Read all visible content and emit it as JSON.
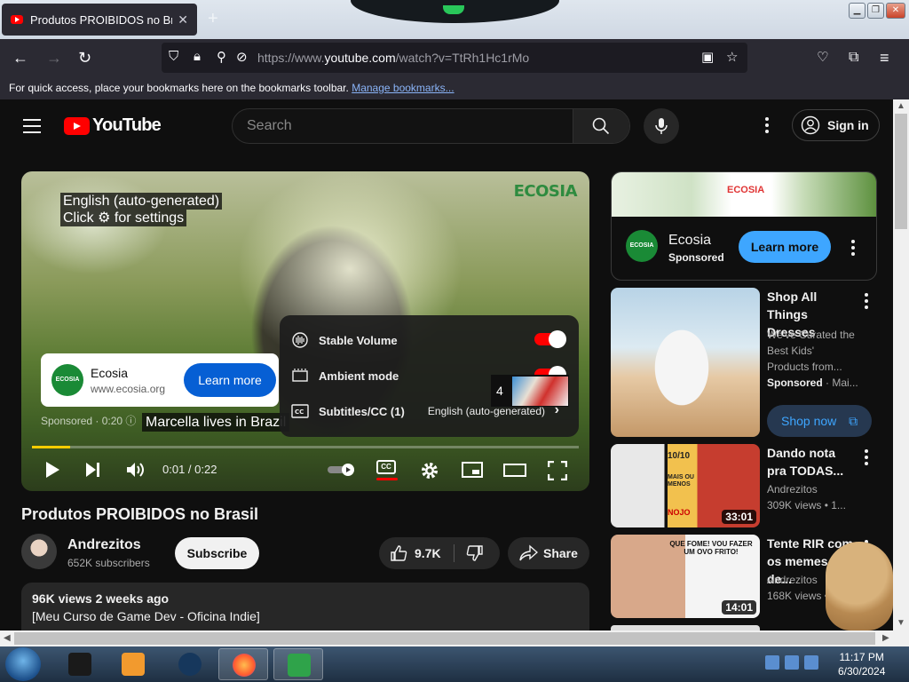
{
  "browser": {
    "tab_title": "Produtos PROIBIDOS no Brasil",
    "tab_close": "✕",
    "new_tab": "+",
    "url_prefix": "https://www.",
    "url_domain": "youtube.com",
    "url_path": "/watch?v=TtRh1Hc1rMo",
    "bookmarks_text": "For quick access, place your bookmarks here on the bookmarks toolbar.",
    "bookmarks_link": "Manage bookmarks..."
  },
  "youtube": {
    "logo_text": "YouTube",
    "search_placeholder": "Search",
    "sign_in": "Sign in"
  },
  "player": {
    "watermark": "ECOSIA",
    "caption_line1": "English (auto-generated)",
    "caption_line2": "Click ⚙ for settings",
    "subtitle_text": "Marcella lives in Brazil",
    "ad": {
      "logo": "ECOSIA",
      "name": "Ecosia",
      "url": "www.ecosia.org",
      "cta": "Learn more",
      "sponsored": "Sponsored · 0:20 ⓘ"
    },
    "progress_fraction": 0.07,
    "time": "0:01 / 0:22",
    "cc_label": "CC",
    "settings": [
      {
        "label": "Stable Volume",
        "kind": "toggle",
        "on": true
      },
      {
        "label": "Ambient mode",
        "kind": "toggle",
        "on": true
      },
      {
        "label": "Subtitles/CC (1)",
        "kind": "value",
        "value": "English (auto-generated)"
      }
    ],
    "queue_number": "4"
  },
  "video": {
    "title": "Produtos PROIBIDOS no Brasil",
    "channel": "Andrezitos",
    "subscribers": "652K subscribers",
    "subscribe": "Subscribe",
    "likes": "9.7K",
    "share": "Share",
    "views_date": "96K views  2 weeks ago",
    "description_first": "[Meu Curso de Game Dev - Oficina Indie]"
  },
  "sidebar": {
    "ad": {
      "banner_brand": "ECOSIA",
      "logo": "ECOSIA",
      "name": "Ecosia",
      "sponsored": "Sponsored",
      "cta": "Learn more"
    },
    "shop_ad": {
      "title": "Shop All Things Dresses",
      "desc": "We've Curated the Best Kids' Products from...",
      "sponsored": "Sponsored",
      "sponsored_rest": " · Mai...",
      "cta": "Shop now"
    },
    "recs": [
      {
        "title": "Dando nota pra TODAS...",
        "channel": "Andrezitos",
        "views": "309K views  • 1...",
        "duration": "33:01"
      },
      {
        "title": "Tente RIR com os memes de...",
        "channel": "Andrezitos",
        "views": "168K views  • 3...",
        "duration": "14:01",
        "thumb_text": "QUE FOME! VOU FAZER UM OVO FRITO!"
      }
    ],
    "rec1_thumb_labels": [
      "10/10",
      "MAIS OU MENOS",
      "NOJO"
    ]
  },
  "taskbar": {
    "time": "11:17 PM",
    "date": "6/30/2024"
  }
}
